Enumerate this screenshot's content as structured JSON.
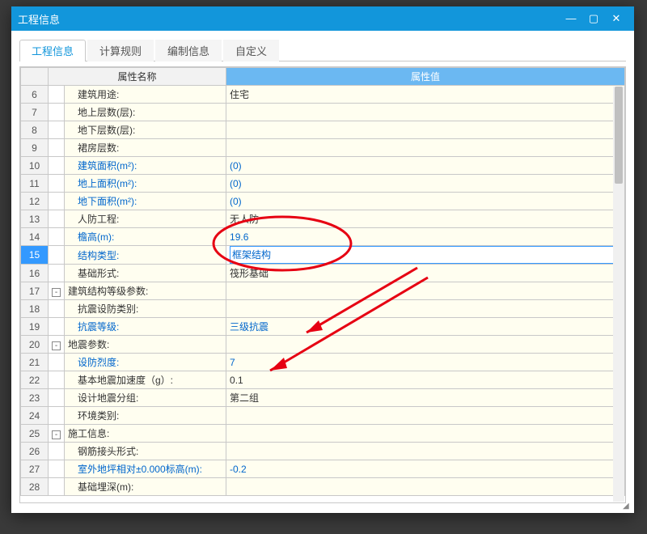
{
  "window_title": "工程信息",
  "window_controls": {
    "min": "—",
    "max": "▢",
    "close": "✕"
  },
  "tabs": {
    "items": [
      {
        "label": "工程信息",
        "active": true
      },
      {
        "label": "计算规则",
        "active": false
      },
      {
        "label": "编制信息",
        "active": false
      },
      {
        "label": "自定义",
        "active": false
      }
    ]
  },
  "grid": {
    "headers": {
      "name": "属性名称",
      "value": "属性值"
    },
    "rows": [
      {
        "num": "6",
        "tree": "",
        "name": "建筑用途:",
        "value": "住宅",
        "blue": false
      },
      {
        "num": "7",
        "tree": "",
        "name": "地上层数(层):",
        "value": "",
        "blue": false
      },
      {
        "num": "8",
        "tree": "",
        "name": "地下层数(层):",
        "value": "",
        "blue": false
      },
      {
        "num": "9",
        "tree": "",
        "name": "裙房层数:",
        "value": "",
        "blue": false
      },
      {
        "num": "10",
        "tree": "",
        "name": "建筑面积(m²):",
        "value": "(0)",
        "blue": true
      },
      {
        "num": "11",
        "tree": "",
        "name": "地上面积(m²):",
        "value": "(0)",
        "blue": true
      },
      {
        "num": "12",
        "tree": "",
        "name": "地下面积(m²):",
        "value": "(0)",
        "blue": true
      },
      {
        "num": "13",
        "tree": "",
        "name": "人防工程:",
        "value": "无人防",
        "blue": false
      },
      {
        "num": "14",
        "tree": "",
        "name": "檐高(m):",
        "value": "19.6",
        "blue": true
      },
      {
        "num": "15",
        "tree": "",
        "name": "结构类型:",
        "value": "框架结构",
        "blue": true,
        "selected": true
      },
      {
        "num": "16",
        "tree": "",
        "name": "基础形式:",
        "value": "筏形基础",
        "blue": false
      },
      {
        "num": "17",
        "tree": "-",
        "name": "建筑结构等级参数:",
        "value": "",
        "blue": false,
        "group": true
      },
      {
        "num": "18",
        "tree": "",
        "name": "抗震设防类别:",
        "value": "",
        "blue": false
      },
      {
        "num": "19",
        "tree": "",
        "name": "抗震等级:",
        "value": "三级抗震",
        "blue": true
      },
      {
        "num": "20",
        "tree": "-",
        "name": "地震参数:",
        "value": "",
        "blue": false,
        "group": true
      },
      {
        "num": "21",
        "tree": "",
        "name": "设防烈度:",
        "value": "7",
        "blue": true
      },
      {
        "num": "22",
        "tree": "",
        "name": "基本地震加速度（g）:",
        "value": "0.1",
        "blue": false
      },
      {
        "num": "23",
        "tree": "",
        "name": "设计地震分组:",
        "value": "第二组",
        "blue": false
      },
      {
        "num": "24",
        "tree": "",
        "name": "环境类别:",
        "value": "",
        "blue": false
      },
      {
        "num": "25",
        "tree": "-",
        "name": "施工信息:",
        "value": "",
        "blue": false,
        "group": true
      },
      {
        "num": "26",
        "tree": "",
        "name": "钢筋接头形式:",
        "value": "",
        "blue": false
      },
      {
        "num": "27",
        "tree": "",
        "name": "室外地坪相对±0.000标高(m):",
        "value": "-0.2",
        "blue": true
      },
      {
        "num": "28",
        "tree": "",
        "name": "基础埋深(m):",
        "value": "",
        "blue": false
      }
    ]
  },
  "annotation_color": "#e60012"
}
